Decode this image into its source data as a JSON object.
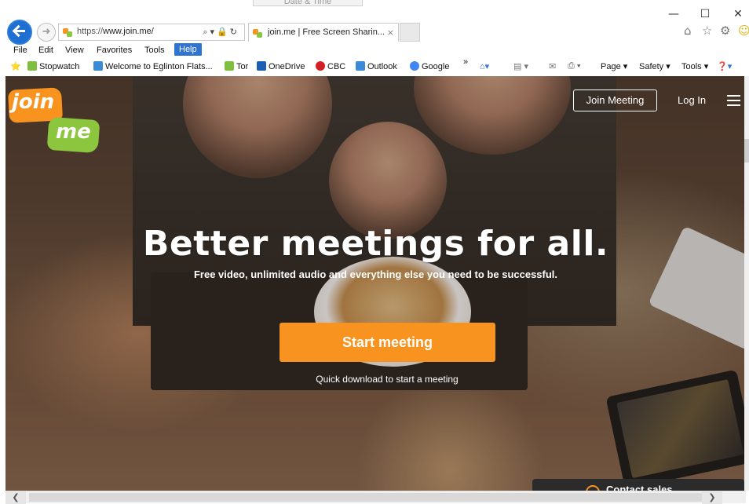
{
  "browser": {
    "background_tab": "Date & Time",
    "address": {
      "protocol": "https://",
      "host": "www.join.me/"
    },
    "tab_title": "join.me | Free Screen Sharin...",
    "tab_close": "×",
    "window_controls": {
      "minimize": "—",
      "maximize": "☐",
      "close": "✕"
    },
    "right_icons": [
      "home-icon",
      "star-icon",
      "gear-icon",
      "smiley-icon"
    ],
    "menu": [
      "File",
      "Edit",
      "View",
      "Favorites",
      "Tools",
      "Help"
    ],
    "favorites": [
      {
        "label": "Stopwatch",
        "icon": "web-slice-icon"
      },
      {
        "label": "Welcome to Eglinton Flats...",
        "icon": "ie-page-icon"
      },
      {
        "label": "Tor",
        "icon": "web-slice-icon"
      },
      {
        "label": "OneDrive",
        "icon": "onedrive-icon"
      },
      {
        "label": "CBC",
        "icon": "cbc-icon"
      },
      {
        "label": "Outlook",
        "icon": "ie-page-icon"
      },
      {
        "label": "Google",
        "icon": "google-icon"
      }
    ],
    "command_bar": {
      "page": "Page",
      "safety": "Safety",
      "tools": "Tools",
      "overflow": "»"
    }
  },
  "site": {
    "logo": {
      "line1": "join",
      "line2": "me"
    },
    "nav": {
      "join_meeting": "Join Meeting",
      "log_in": "Log In"
    },
    "hero": {
      "headline": "Better meetings for all.",
      "subheadline": "Free video, unlimited audio and everything else you need to be successful.",
      "cta": "Start meeting",
      "cta_note": "Quick download to start a meeting"
    },
    "contact_sales": "Contact sales"
  },
  "colors": {
    "brand_orange": "#f7931e",
    "brand_green": "#8cc63f",
    "ie_blue": "#2f74d0"
  }
}
